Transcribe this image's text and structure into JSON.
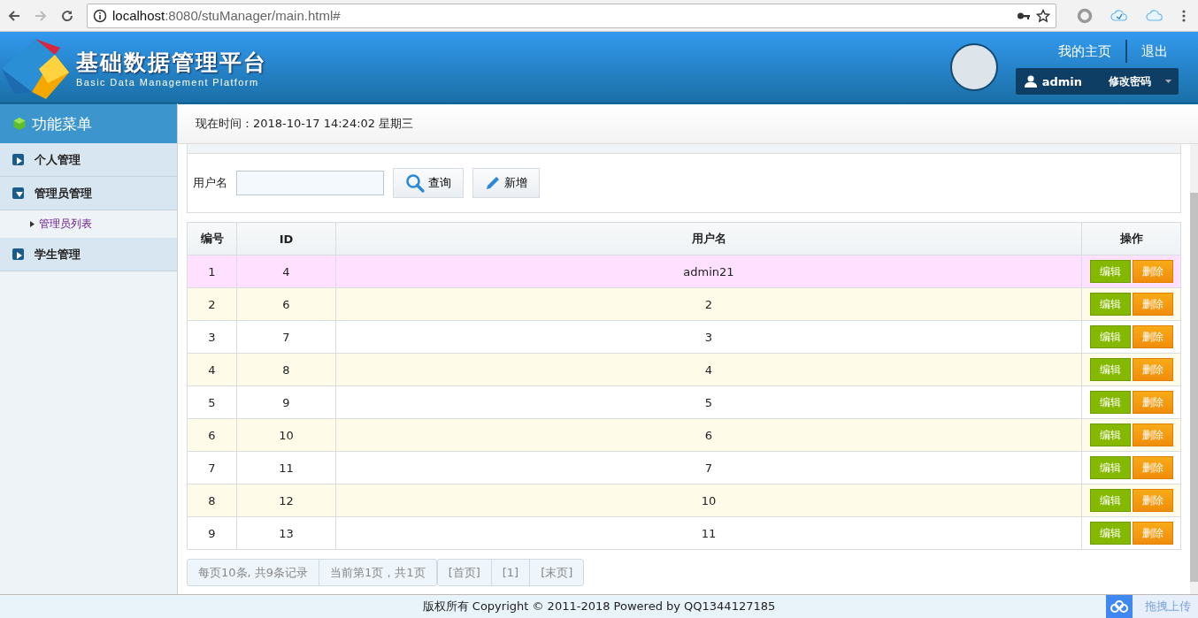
{
  "browser": {
    "url_host": "localhost",
    "url_rest": ":8080/stuManager/main.html#"
  },
  "header": {
    "title": "基础数据管理平台",
    "subtitle": "Basic Data Management Platform",
    "links": [
      "我的主页",
      "退出"
    ],
    "user": "admin",
    "change_password": "修改密码"
  },
  "sidebar": {
    "title": "功能菜单",
    "items": [
      {
        "label": "个人管理",
        "expanded": false
      },
      {
        "label": "管理员管理",
        "expanded": true,
        "children": [
          {
            "label": "管理员列表"
          }
        ]
      },
      {
        "label": "学生管理",
        "expanded": false
      }
    ]
  },
  "time_bar": "现在时间：2018-10-17 14:24:02 星期三",
  "search": {
    "label": "用户名",
    "buttons": [
      "查询",
      "新增"
    ]
  },
  "table": {
    "columns": [
      "编号",
      "ID",
      "用户名",
      "操作"
    ],
    "rows": [
      {
        "cells": [
          "1",
          "4",
          "admin21"
        ],
        "actions": [
          "编辑",
          "删除"
        ],
        "selected": true
      },
      {
        "cells": [
          "2",
          "6",
          "2"
        ],
        "actions": [
          "编辑",
          "删除"
        ],
        "selected": false
      },
      {
        "cells": [
          "3",
          "7",
          "3"
        ],
        "actions": [
          "编辑",
          "删除"
        ],
        "selected": false
      },
      {
        "cells": [
          "4",
          "8",
          "4"
        ],
        "actions": [
          "编辑",
          "删除"
        ],
        "selected": false
      },
      {
        "cells": [
          "5",
          "9",
          "5"
        ],
        "actions": [
          "编辑",
          "删除"
        ],
        "selected": false
      },
      {
        "cells": [
          "6",
          "10",
          "6"
        ],
        "actions": [
          "编辑",
          "删除"
        ],
        "selected": false
      },
      {
        "cells": [
          "7",
          "11",
          "7"
        ],
        "actions": [
          "编辑",
          "删除"
        ],
        "selected": false
      },
      {
        "cells": [
          "8",
          "12",
          "10"
        ],
        "actions": [
          "编辑",
          "删除"
        ],
        "selected": false
      },
      {
        "cells": [
          "9",
          "13",
          "11"
        ],
        "actions": [
          "编辑",
          "删除"
        ],
        "selected": false
      }
    ]
  },
  "pagination": {
    "info": [
      "每页10条, 共9条记录",
      "当前第1页，共1页"
    ],
    "links": [
      "[首页]",
      "[1]",
      "[末页]"
    ]
  },
  "footer": "版权所有 Copyright © 2011-2018 Powered by QQ1344127185",
  "upload_widget": "拖拽上传"
}
